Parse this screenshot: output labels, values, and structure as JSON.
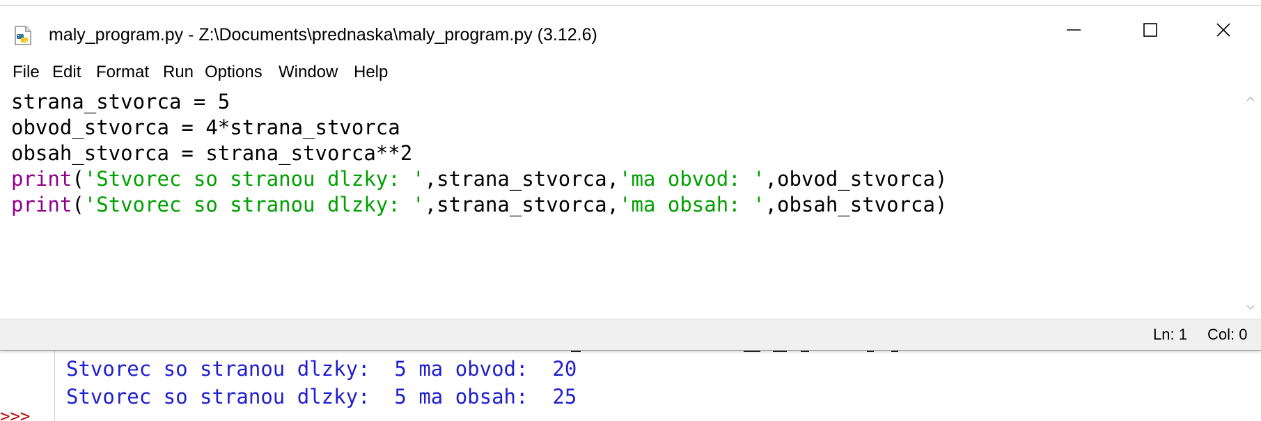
{
  "window": {
    "title": "maly_program.py - Z:\\Documents\\prednaska\\maly_program.py (3.12.6)",
    "icon": "python-file-icon",
    "controls": {
      "minimize": "minimize-icon",
      "maximize": "maximize-icon",
      "close": "close-icon"
    }
  },
  "menu": {
    "items": [
      "File",
      "Edit",
      "Format",
      "Run",
      "Options",
      "Window",
      "Help"
    ]
  },
  "editor": {
    "lines": [
      [
        {
          "t": "strana_stvorca = 5",
          "k": "plain"
        }
      ],
      [
        {
          "t": "obvod_stvorca = 4*strana_stvorca",
          "k": "plain"
        }
      ],
      [
        {
          "t": "obsah_stvorca = strana_stvorca**2",
          "k": "plain"
        }
      ],
      [
        {
          "t": "print",
          "k": "keyword"
        },
        {
          "t": "(",
          "k": "plain"
        },
        {
          "t": "'Stvorec so stranou dlzky: '",
          "k": "string"
        },
        {
          "t": ",strana_stvorca,",
          "k": "plain"
        },
        {
          "t": "'ma obvod: '",
          "k": "string"
        },
        {
          "t": ",obvod_stvorca)",
          "k": "plain"
        }
      ],
      [
        {
          "t": "print",
          "k": "keyword"
        },
        {
          "t": "(",
          "k": "plain"
        },
        {
          "t": "'Stvorec so stranou dlzky: '",
          "k": "string"
        },
        {
          "t": ",strana_stvorca,",
          "k": "plain"
        },
        {
          "t": "'ma obsah: '",
          "k": "string"
        },
        {
          "t": ",obsah_stvorca)",
          "k": "plain"
        }
      ]
    ],
    "colors": {
      "keyword": "#900090",
      "string": "#00a000",
      "plain": "#000000"
    }
  },
  "status": {
    "line": "Ln: 1",
    "col": "Col: 0"
  },
  "shell": {
    "output": [
      "Stvorec so stranou dlzky:  5 ma obvod:  20",
      "Stvorec so stranou dlzky:  5 ma obsah:  25"
    ],
    "prompt": ">>>",
    "output_color": "#1f1fd0",
    "prompt_color": "#c00000"
  }
}
